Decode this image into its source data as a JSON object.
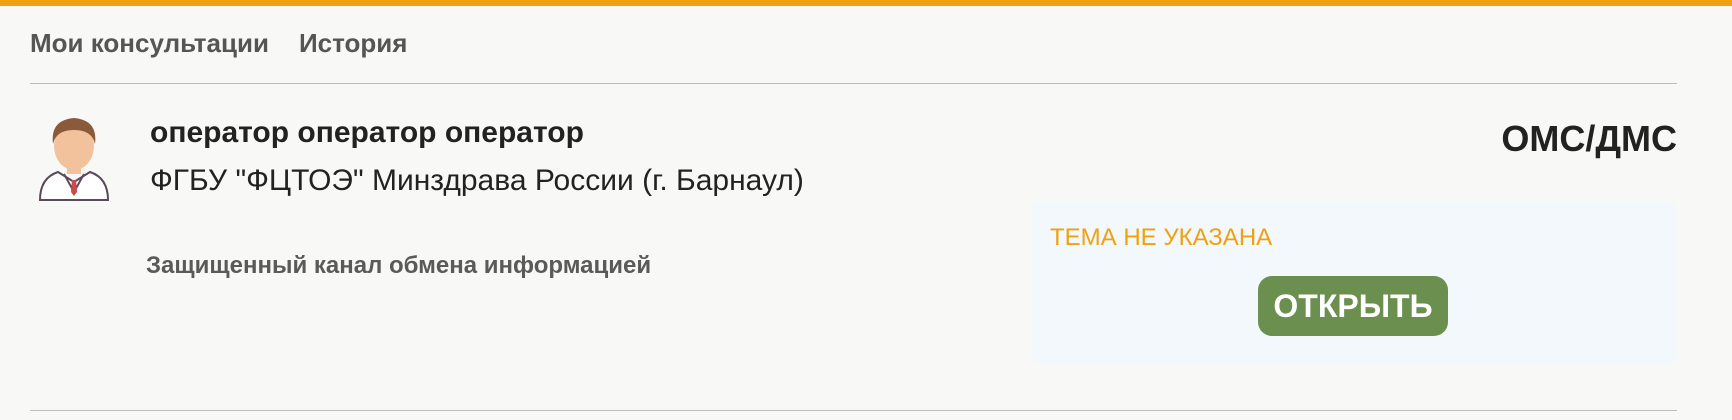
{
  "tabs": [
    {
      "label": "Мои консультации"
    },
    {
      "label": "История"
    }
  ],
  "consultation": {
    "avatar_icon": "doctor-avatar-icon",
    "operator_name": "оператор оператор оператор",
    "organization": "ФГБУ \"ФЦТОЭ\" Минздрава России (г. Барнаул)",
    "channel": "Защищенный канал обмена информацией",
    "payment_type": "ОМС/ДМС",
    "topic": "ТЕМА НЕ УКАЗАНА",
    "open_button": "ОТКРЫТЬ"
  },
  "colors": {
    "accent": "#f0a10f",
    "button": "#6b8f4e",
    "card_bg": "#f3f8fc"
  }
}
